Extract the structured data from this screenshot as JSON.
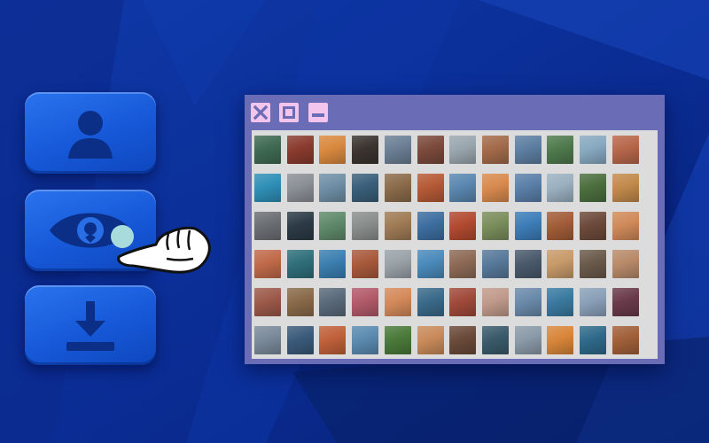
{
  "palette": {
    "background": "#0a2a8c",
    "button": "#1f66e6",
    "icon": "#0b2f87",
    "window_frame": "#6a6cb6",
    "window_controls": "#f3c4ec",
    "grid_background": "#dcdcdc"
  },
  "sidebar": {
    "buttons": [
      {
        "name": "profile",
        "icon": "user-icon"
      },
      {
        "name": "view",
        "icon": "eye-icon",
        "active": true
      },
      {
        "name": "download",
        "icon": "download-icon"
      }
    ]
  },
  "cursor": {
    "icon": "pointing-hand-icon"
  },
  "window": {
    "controls": [
      {
        "name": "close",
        "icon": "close-icon"
      },
      {
        "name": "maximize",
        "icon": "maximize-icon"
      },
      {
        "name": "minimize",
        "icon": "minimize-icon"
      }
    ],
    "gallery": {
      "rows": 6,
      "columns": 12,
      "thumbnail_colors": [
        [
          "#3f6a52",
          "#8a3b2e",
          "#d9893f",
          "#3b3430",
          "#6b7f94",
          "#7b4a3c",
          "#9aa6ae",
          "#a36a4a",
          "#5d7fa1",
          "#4f7a4d",
          "#87a9c1",
          "#b7674b"
        ],
        [
          "#2f8fb6",
          "#8b8f96",
          "#6f8fa6",
          "#3a5f7a",
          "#8b6b4a",
          "#b55a36",
          "#5a87b0",
          "#d88a4e",
          "#5a7fa8",
          "#9ab0c0",
          "#4c6f3e",
          "#c28a4c"
        ],
        [
          "#6b6f74",
          "#2c3b46",
          "#5f8a6a",
          "#8a8f8e",
          "#9f7b55",
          "#3d6ea0",
          "#b24a30",
          "#7a8e5c",
          "#3d7db8",
          "#a25d39",
          "#6d4a3a",
          "#d08a5a"
        ],
        [
          "#c06a4a",
          "#2f6f7a",
          "#3b7fb0",
          "#a85a3c",
          "#9aa2a8",
          "#4a8abb",
          "#8d6a56",
          "#57799a",
          "#4a5a6c",
          "#c79a6a",
          "#6a5a4a",
          "#b88a6a"
        ],
        [
          "#9c5a4a",
          "#8a6a4a",
          "#5a6a7a",
          "#b25a6a",
          "#d48a5a",
          "#3a6a8a",
          "#a04a3a",
          "#c09a8a",
          "#6a8aaa",
          "#3a7aa0",
          "#8aa0b8",
          "#6a3a4a"
        ],
        [
          "#7a8a9a",
          "#3a5a7a",
          "#c0603a",
          "#5a8ab0",
          "#4a7a3a",
          "#c98a5a",
          "#6a4a3a",
          "#3a5a6a",
          "#8a9aa8",
          "#d8863a",
          "#2f6a8a",
          "#a0603a"
        ]
      ]
    }
  }
}
